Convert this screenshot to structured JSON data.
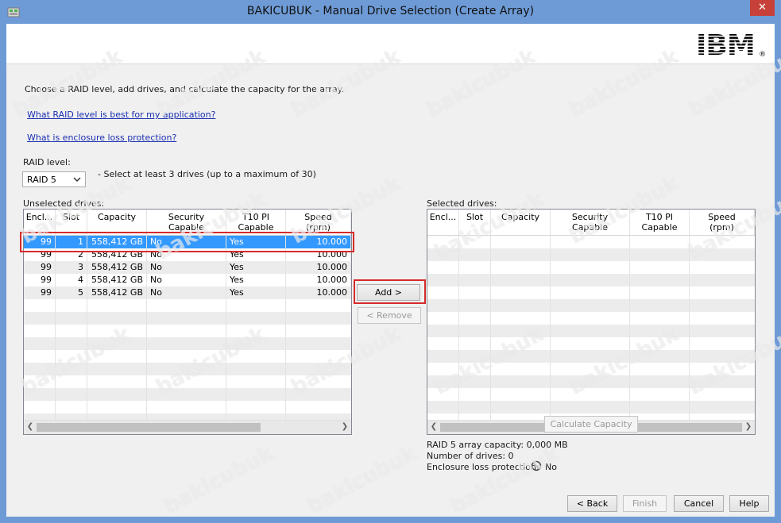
{
  "window": {
    "title": "BAKICUBUK - Manual Drive Selection (Create Array)",
    "close_glyph": "✕"
  },
  "logo": {
    "text": "IBM",
    "registered": "®"
  },
  "instructions": "Choose a RAID level, add drives, and calculate the capacity for the array.",
  "links": {
    "raid_help": "What RAID level is best for my application?",
    "enclosure_help": "What is enclosure loss protection?"
  },
  "raid": {
    "label": "RAID level:",
    "selected": "RAID 5",
    "hint": "- Select at least 3 drives (up to a maximum of 30)"
  },
  "unselected": {
    "label": "Unselected drives:",
    "columns": [
      {
        "l1": "Encl...",
        "l2": ""
      },
      {
        "l1": "Slot",
        "l2": ""
      },
      {
        "l1": "Capacity",
        "l2": ""
      },
      {
        "l1": "Security",
        "l2": "Capable"
      },
      {
        "l1": "T10 PI",
        "l2": "Capable"
      },
      {
        "l1": "Speed",
        "l2": "(rpm)"
      }
    ],
    "rows": [
      {
        "encl": "99",
        "slot": "1",
        "capacity": "558,412 GB",
        "security": "No",
        "t10": "Yes",
        "speed": "10.000"
      },
      {
        "encl": "99",
        "slot": "2",
        "capacity": "558,412 GB",
        "security": "No",
        "t10": "Yes",
        "speed": "10.000"
      },
      {
        "encl": "99",
        "slot": "3",
        "capacity": "558,412 GB",
        "security": "No",
        "t10": "Yes",
        "speed": "10.000"
      },
      {
        "encl": "99",
        "slot": "4",
        "capacity": "558,412 GB",
        "security": "No",
        "t10": "Yes",
        "speed": "10.000"
      },
      {
        "encl": "99",
        "slot": "5",
        "capacity": "558,412 GB",
        "security": "No",
        "t10": "Yes",
        "speed": "10.000"
      }
    ]
  },
  "selected": {
    "label": "Selected drives:",
    "columns": [
      {
        "l1": "Encl...",
        "l2": ""
      },
      {
        "l1": "Slot",
        "l2": ""
      },
      {
        "l1": "Capacity",
        "l2": ""
      },
      {
        "l1": "Security",
        "l2": "Capable"
      },
      {
        "l1": "T10 PI",
        "l2": "Capable"
      },
      {
        "l1": "Speed",
        "l2": "(rpm)"
      }
    ]
  },
  "buttons": {
    "add": "Add >",
    "remove": "< Remove",
    "calculate": "Calculate Capacity",
    "back": "< Back",
    "finish": "Finish",
    "cancel": "Cancel",
    "help": "Help"
  },
  "summary": {
    "capacity": "RAID 5 array capacity: 0,000 MB",
    "drives": "Number of drives: 0",
    "enclosure_label": "Enclosure loss protection:",
    "enclosure_value": "No"
  },
  "watermark": "bakicubuk",
  "colors": {
    "titlebar": "#6e9bd6",
    "selection": "#3399ff",
    "highlight_box": "#d62a2a",
    "link": "#1a2fb0"
  }
}
